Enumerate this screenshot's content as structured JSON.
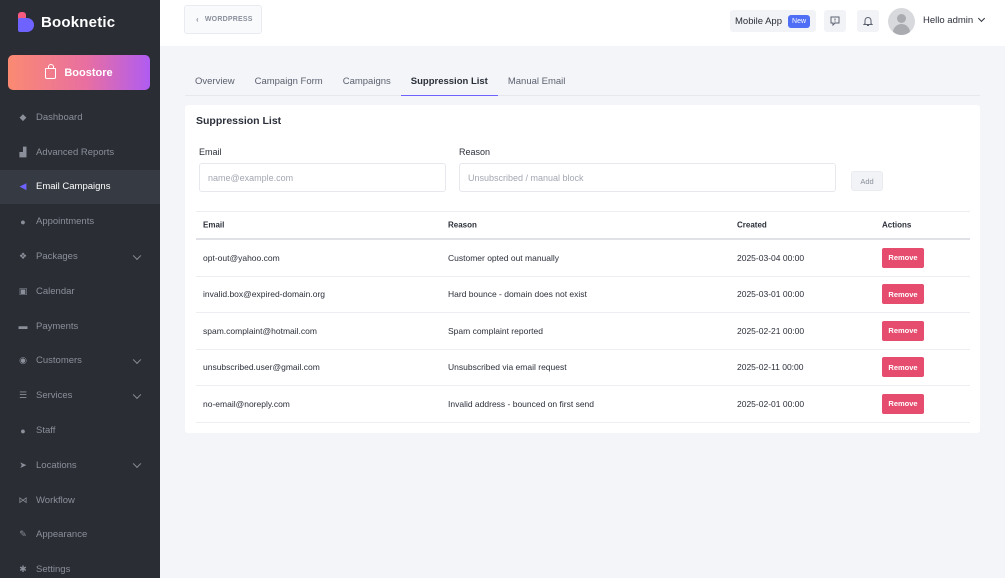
{
  "brand": {
    "name": "Booknetic"
  },
  "boostore": {
    "label": "Boostore"
  },
  "sidebar": {
    "items": [
      {
        "label": "Dashboard",
        "icon": "dashboard-icon",
        "has_children": false,
        "active": false
      },
      {
        "label": "Advanced Reports",
        "icon": "chart-icon",
        "has_children": false,
        "active": false
      },
      {
        "label": "Email Campaigns",
        "icon": "megaphone-icon",
        "has_children": false,
        "active": true
      },
      {
        "label": "Appointments",
        "icon": "clock-icon",
        "has_children": false,
        "active": false
      },
      {
        "label": "Packages",
        "icon": "packages-icon",
        "has_children": true,
        "active": false
      },
      {
        "label": "Calendar",
        "icon": "calendar-icon",
        "has_children": false,
        "active": false
      },
      {
        "label": "Payments",
        "icon": "payments-icon",
        "has_children": false,
        "active": false
      },
      {
        "label": "Customers",
        "icon": "customers-icon",
        "has_children": true,
        "active": false
      },
      {
        "label": "Services",
        "icon": "services-icon",
        "has_children": true,
        "active": false
      },
      {
        "label": "Staff",
        "icon": "staff-icon",
        "has_children": false,
        "active": false
      },
      {
        "label": "Locations",
        "icon": "location-icon",
        "has_children": true,
        "active": false
      },
      {
        "label": "Workflow",
        "icon": "workflow-icon",
        "has_children": false,
        "active": false
      },
      {
        "label": "Appearance",
        "icon": "brush-icon",
        "has_children": false,
        "active": false
      },
      {
        "label": "Settings",
        "icon": "settings-icon",
        "has_children": false,
        "active": false
      }
    ]
  },
  "topbar": {
    "wordpress_label": "WORDPRESS",
    "mobile_app_label": "Mobile App",
    "mobile_app_badge": "New",
    "greeting": "Hello admin"
  },
  "tabs": [
    {
      "label": "Overview",
      "active": false
    },
    {
      "label": "Campaign Form",
      "active": false
    },
    {
      "label": "Campaigns",
      "active": false
    },
    {
      "label": "Suppression List",
      "active": true
    },
    {
      "label": "Manual Email",
      "active": false
    }
  ],
  "suppression": {
    "title": "Suppression List",
    "email_label": "Email",
    "email_placeholder": "name@example.com",
    "email_value": "",
    "reason_label": "Reason",
    "reason_placeholder": "Unsubscribed / manual block",
    "reason_value": "",
    "add_label": "Add"
  },
  "table": {
    "headers": {
      "email": "Email",
      "reason": "Reason",
      "created": "Created",
      "actions": "Actions"
    },
    "remove_label": "Remove",
    "rows": [
      {
        "email": "opt-out@yahoo.com",
        "reason": "Customer opted out manually",
        "created": "2025-03-04 00:00"
      },
      {
        "email": "invalid.box@expired-domain.org",
        "reason": "Hard bounce - domain does not exist",
        "created": "2025-03-01 00:00"
      },
      {
        "email": "spam.complaint@hotmail.com",
        "reason": "Spam complaint reported",
        "created": "2025-02-21 00:00"
      },
      {
        "email": "unsubscribed.user@gmail.com",
        "reason": "Unsubscribed via email request",
        "created": "2025-02-11 00:00"
      },
      {
        "email": "no-email@noreply.com",
        "reason": "Invalid address - bounced on first send",
        "created": "2025-02-01 00:00"
      }
    ]
  },
  "colors": {
    "accent": "#6f63ff",
    "danger": "#e54c6e",
    "sidebar": "#2a2d34"
  }
}
